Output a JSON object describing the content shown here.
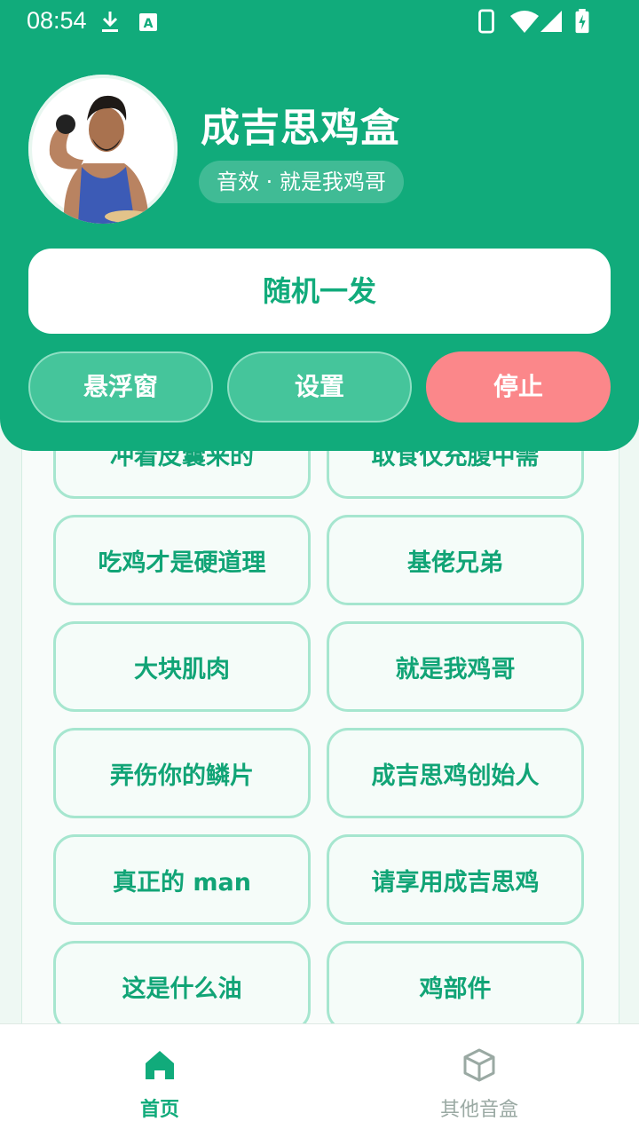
{
  "status_bar": {
    "time": "08:54",
    "left_icons": [
      "download-icon",
      "keyboard-a-icon"
    ],
    "right_icons": [
      "phone-icon",
      "wifi-icon",
      "signal-icon",
      "battery-charging-icon"
    ]
  },
  "profile": {
    "title": "成吉思鸡盒",
    "subtitle": "音效 · 就是我鸡哥",
    "avatar": "avatar-image"
  },
  "actions": {
    "random_label": "随机一发",
    "float_label": "悬浮窗",
    "settings_label": "设置",
    "stop_label": "停止"
  },
  "sounds": [
    "冲着皮囊来的",
    "取食仅充腹中需",
    "吃鸡才是硬道理",
    "基佬兄弟",
    "大块肌肉",
    "就是我鸡哥",
    "弄伤你的鳞片",
    "成吉思鸡创始人",
    "真正的 man",
    "请享用成吉思鸡",
    "这是什么油",
    "鸡部件"
  ],
  "nav": {
    "home_label": "首页",
    "other_label": "其他音盒",
    "home_icon": "home-icon",
    "other_icon": "box-icon"
  },
  "colors": {
    "primary": "#11ab7b",
    "stop": "#fb878a",
    "inactive": "#9aa9a3"
  }
}
